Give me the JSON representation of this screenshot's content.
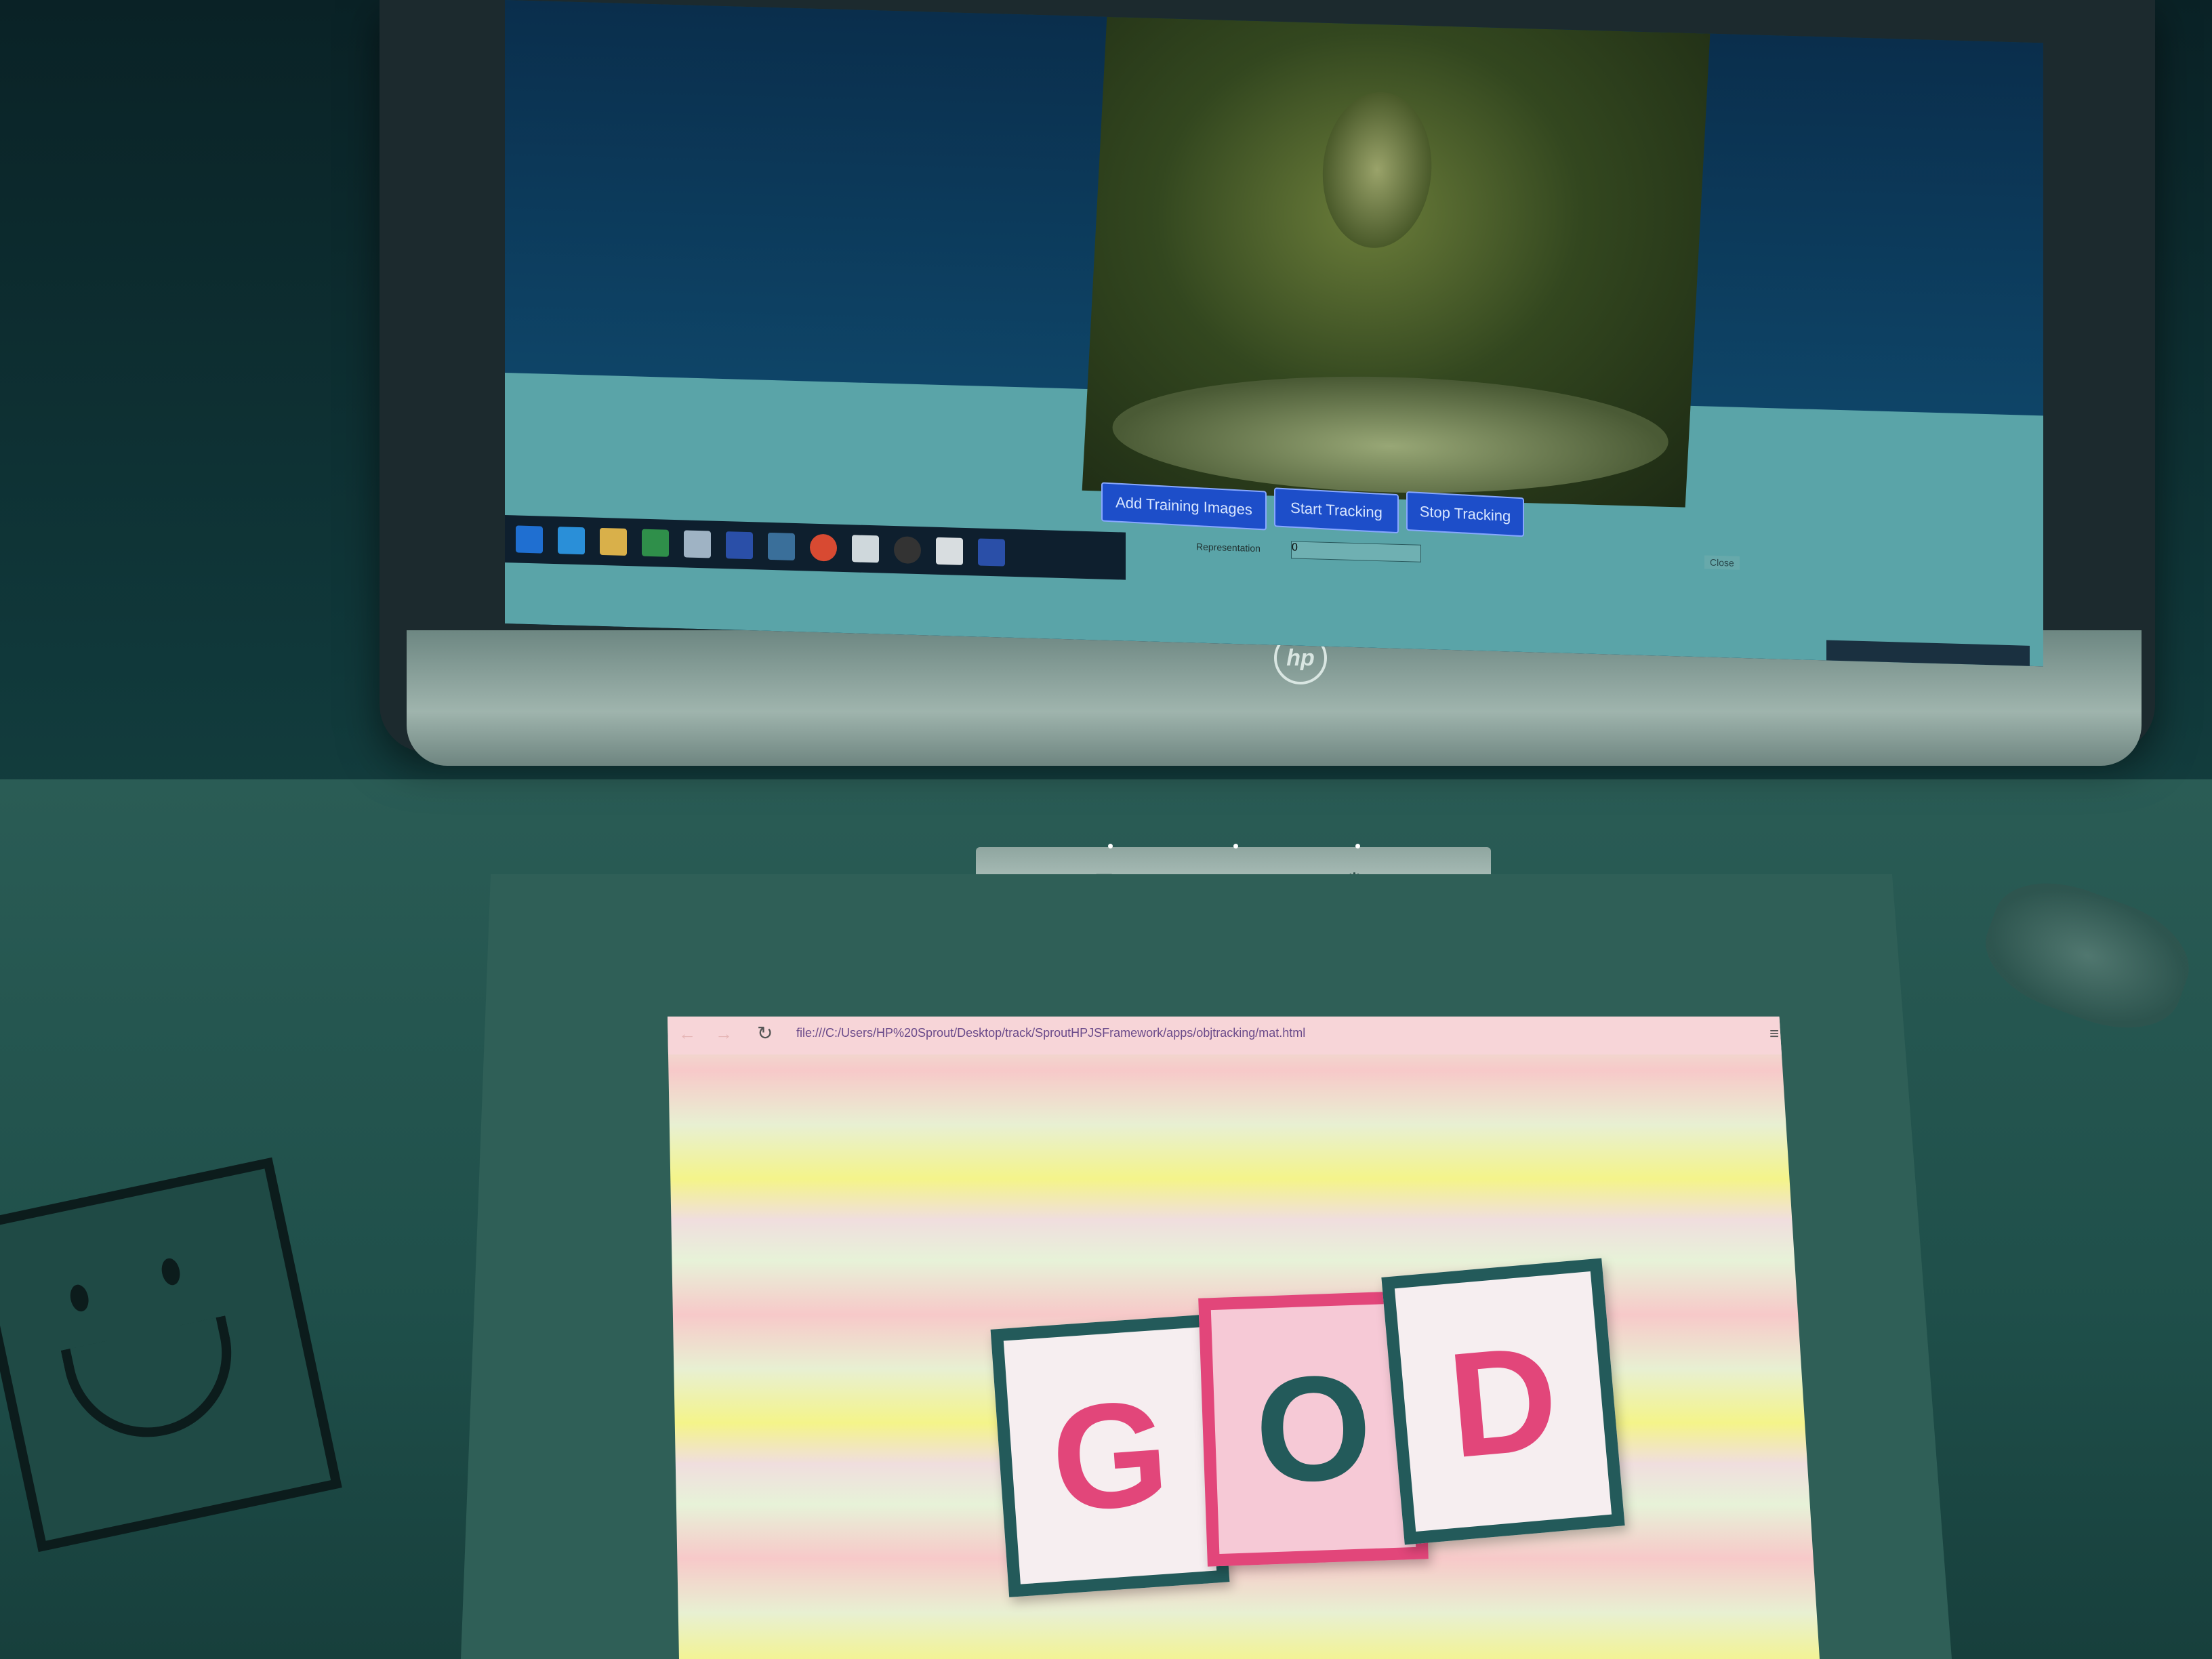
{
  "screen": {
    "buttons": {
      "add_training": "Add Training Images",
      "start_tracking": "Start Tracking",
      "stop_tracking": "Stop Tracking"
    },
    "representation_label": "Representation",
    "representation_value": "0",
    "close_label": "Close"
  },
  "monitor": {
    "brand": "hp"
  },
  "projected_browser": {
    "url": "file:///C:/Users/HP%20Sprout/Desktop/track/SproutHPJSFramework/apps/objtracking/mat.html",
    "reload_icon": "reload-icon"
  },
  "cards": [
    {
      "letter": "G",
      "color": "#e2467a"
    },
    {
      "letter": "O",
      "color": "#235a5a"
    },
    {
      "letter": "D",
      "color": "#e2467a"
    }
  ]
}
